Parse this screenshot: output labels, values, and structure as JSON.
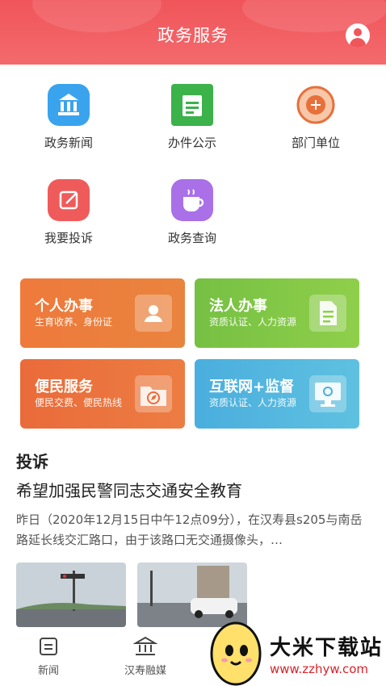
{
  "header": {
    "title": "政务服务",
    "user_icon": "user-icon",
    "color": "#f0555a"
  },
  "grid": [
    {
      "label": "政务新闻",
      "icon": "bank-icon",
      "color": "#3aa3ee"
    },
    {
      "label": "办件公示",
      "icon": "document-icon",
      "color": "#3bb24a"
    },
    {
      "label": "部门单位",
      "icon": "emblem-icon",
      "color": "#e8703a"
    },
    {
      "label": "我要投诉",
      "icon": "edit-icon",
      "color": "#ef5b5b"
    },
    {
      "label": "政务查询",
      "icon": "cup-icon",
      "color": "#a970e8"
    }
  ],
  "cards": [
    {
      "title": "个人办事",
      "subtitle": "生育收养、身份证",
      "icon": "id-card-icon",
      "color": "#ec7a3a"
    },
    {
      "title": "法人办事",
      "subtitle": "资质认证、人力资源",
      "icon": "file-icon",
      "color": "#7cc544"
    },
    {
      "title": "便民服务",
      "subtitle": "便民交费、便民热线",
      "icon": "folder-compass-icon",
      "color": "#e8673a"
    },
    {
      "title": "互联网+监督",
      "subtitle": "资质认证、人力资源",
      "icon": "monitor-icon",
      "color": "#4fb4dc"
    }
  ],
  "section": {
    "title": "投诉"
  },
  "news": {
    "title": "希望加强民警同志交通安全教育",
    "summary": "昨日（2020年12月15日中午12点09分），在汉寿县s205与南岳路延长线交汇路口，由于该路口无交通摄像头，…"
  },
  "tabs": [
    {
      "label": "新闻",
      "icon": "news-icon"
    },
    {
      "label": "汉寿融媒",
      "icon": "institution-icon"
    }
  ],
  "watermark": {
    "text": "大米下载站",
    "url": "www.zzhyw.com"
  }
}
